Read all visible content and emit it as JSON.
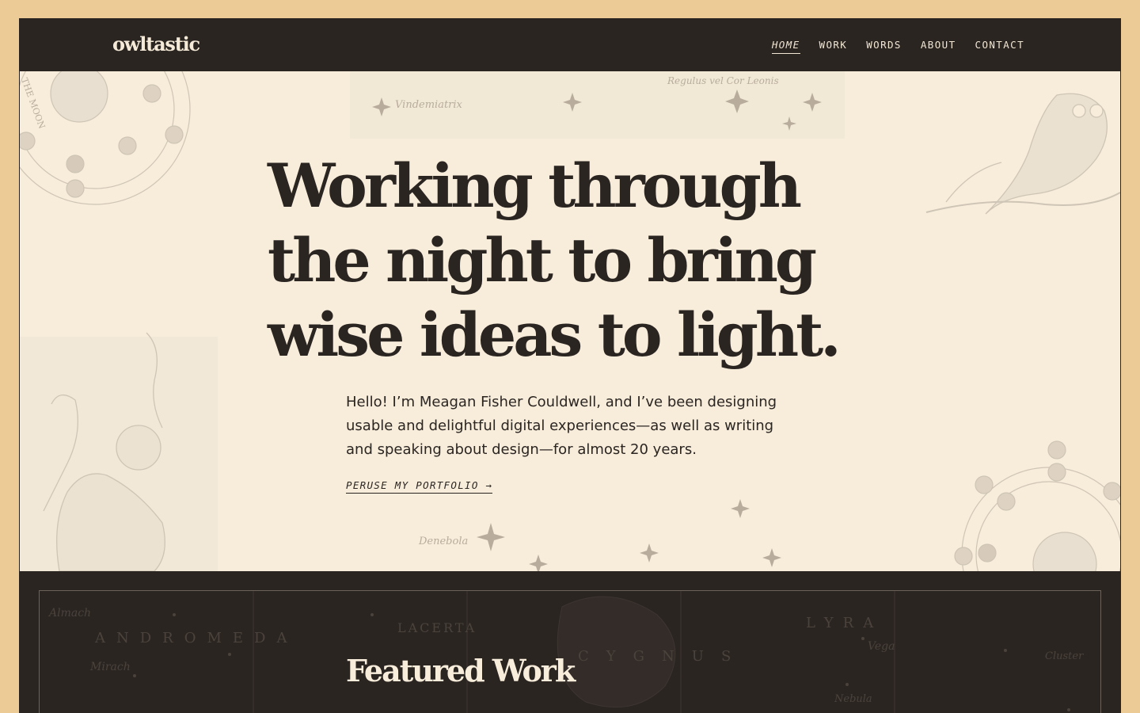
{
  "header": {
    "logo": "owltastic",
    "nav": [
      {
        "label": "HOME",
        "active": true
      },
      {
        "label": "WORK",
        "active": false
      },
      {
        "label": "WORDS",
        "active": false
      },
      {
        "label": "ABOUT",
        "active": false
      },
      {
        "label": "CONTACT",
        "active": false
      }
    ]
  },
  "hero": {
    "title": "Working through the night to bring wise ideas to light.",
    "intro": "Hello! I’m Meagan Fisher Couldwell, and I’ve been designing usable and delightful digital experiences—as well as writing and speaking about design—for almost 20 years.",
    "cta": "PERUSE MY PORTFOLIO →",
    "illustration_labels": {
      "top_star_1": "Vindemiatrix",
      "top_star_2": "Regulus vel Cor Leonis",
      "bottom_star": "Denebola",
      "moon_ring": "THE MOON"
    }
  },
  "featured": {
    "title": "Featured Work",
    "map_labels": [
      "Almach",
      "ANDROMEDA",
      "Mirach",
      "LACERTA",
      "CYGNUS",
      "LYRA",
      "Vega",
      "Nebula",
      "Cluster"
    ]
  },
  "colors": {
    "page_border": "#eccb96",
    "dark": "#2b2522",
    "cream": "#f8eddb"
  }
}
